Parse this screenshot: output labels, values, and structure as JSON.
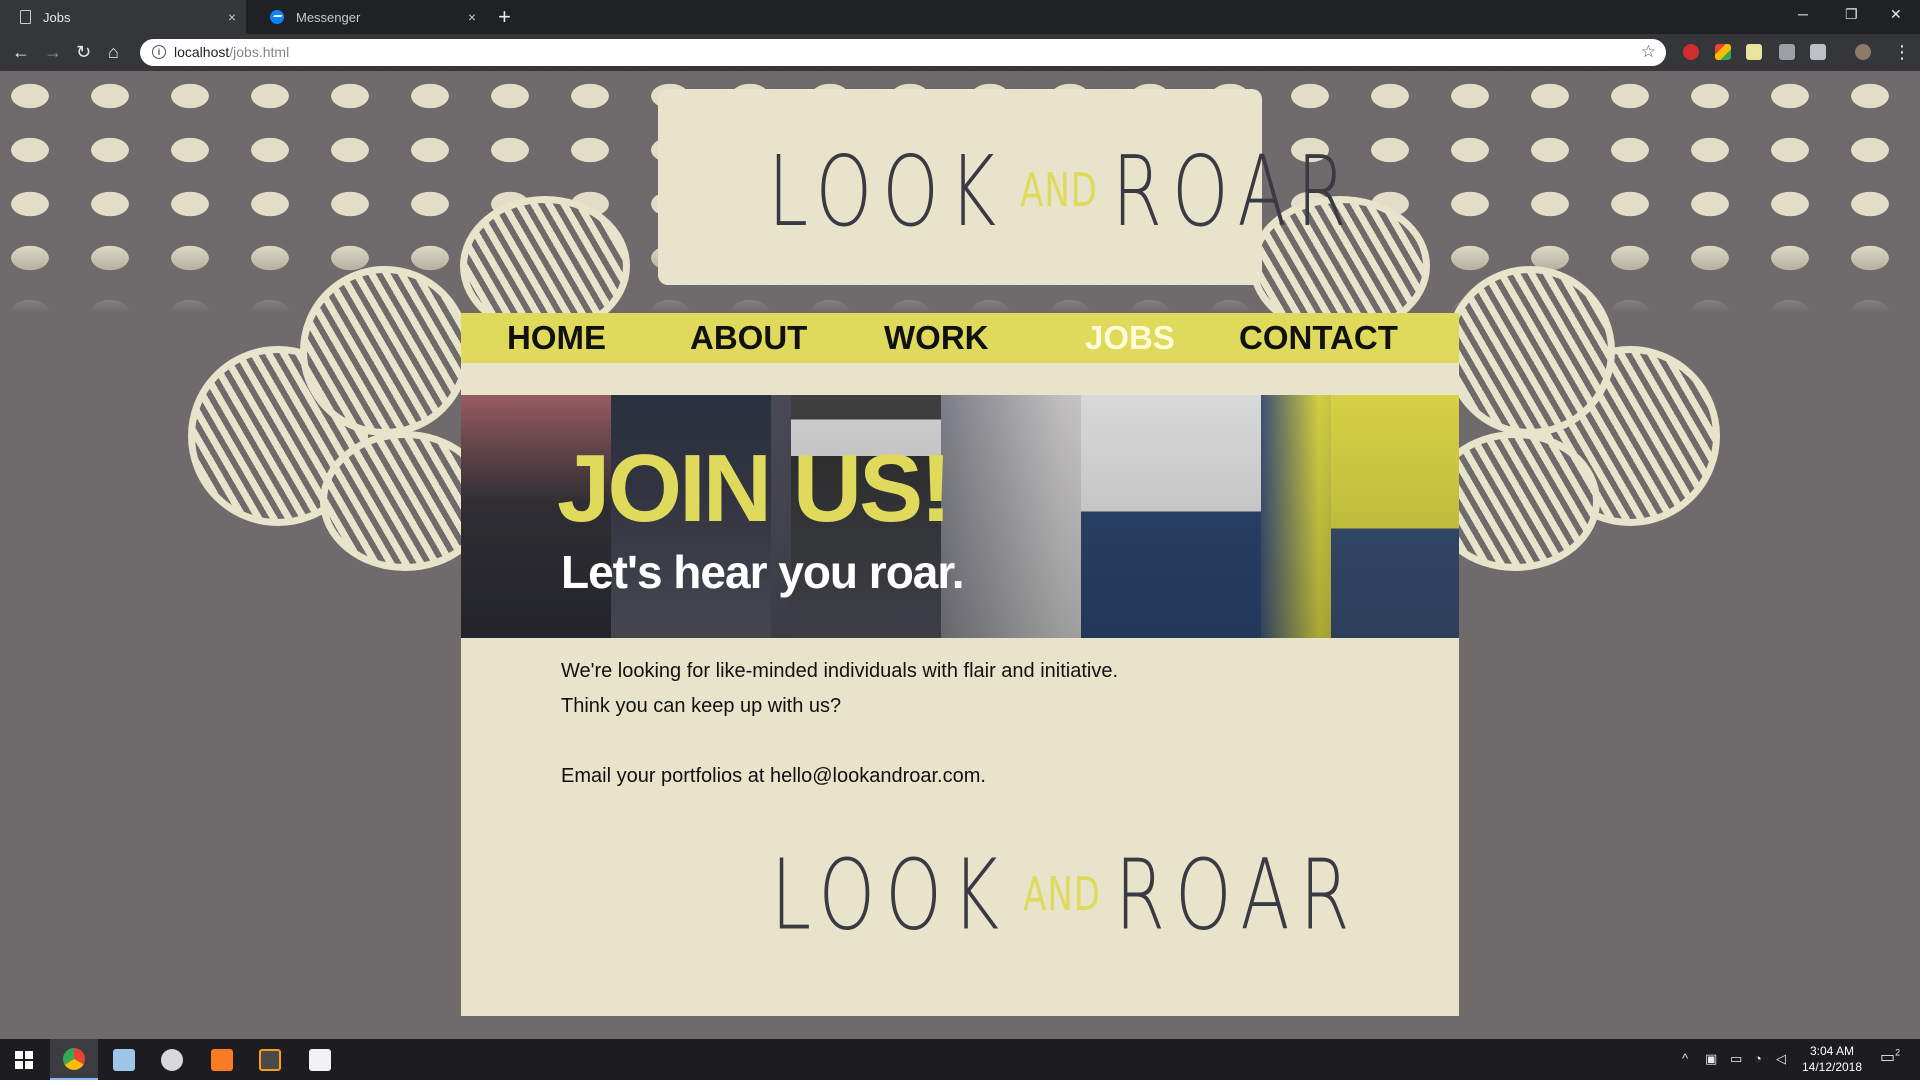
{
  "browser": {
    "tabs": [
      {
        "title": "Jobs",
        "active": true
      },
      {
        "title": "Messenger",
        "active": false
      }
    ],
    "url_host": "localhost",
    "url_path": "/jobs.html",
    "window_controls": {
      "minimize": "─",
      "restore": "❐",
      "close": "✕"
    },
    "new_tab": "+",
    "tab_close": "×"
  },
  "site": {
    "logo": {
      "look": "LOOK",
      "and": "AND",
      "roar": "ROAR"
    },
    "nav": [
      {
        "label": "HOME",
        "active": false
      },
      {
        "label": "ABOUT",
        "active": false
      },
      {
        "label": "WORK",
        "active": false
      },
      {
        "label": "JOBS",
        "active": true
      },
      {
        "label": "CONTACT",
        "active": false
      }
    ],
    "hero": {
      "title": "JOIN US!",
      "subtitle": "Let's hear you roar."
    },
    "content": {
      "line1": "We're looking for like-minded individuals with flair and initiative.",
      "line2": "Think you can keep up with us?",
      "line3": "Email your portfolios at hello@lookandroar.com."
    },
    "colors": {
      "accent": "#dfd95c",
      "cream": "#e8e4cc",
      "background": "#6f6b6c",
      "logo_dark": "#3a3a44"
    }
  },
  "taskbar": {
    "apps": [
      "windows-start",
      "chrome",
      "notepad",
      "paint",
      "xampp",
      "sublime-text",
      "photos"
    ],
    "clock_time": "3:04 AM",
    "clock_date": "14/12/2018",
    "notifications": "2"
  }
}
